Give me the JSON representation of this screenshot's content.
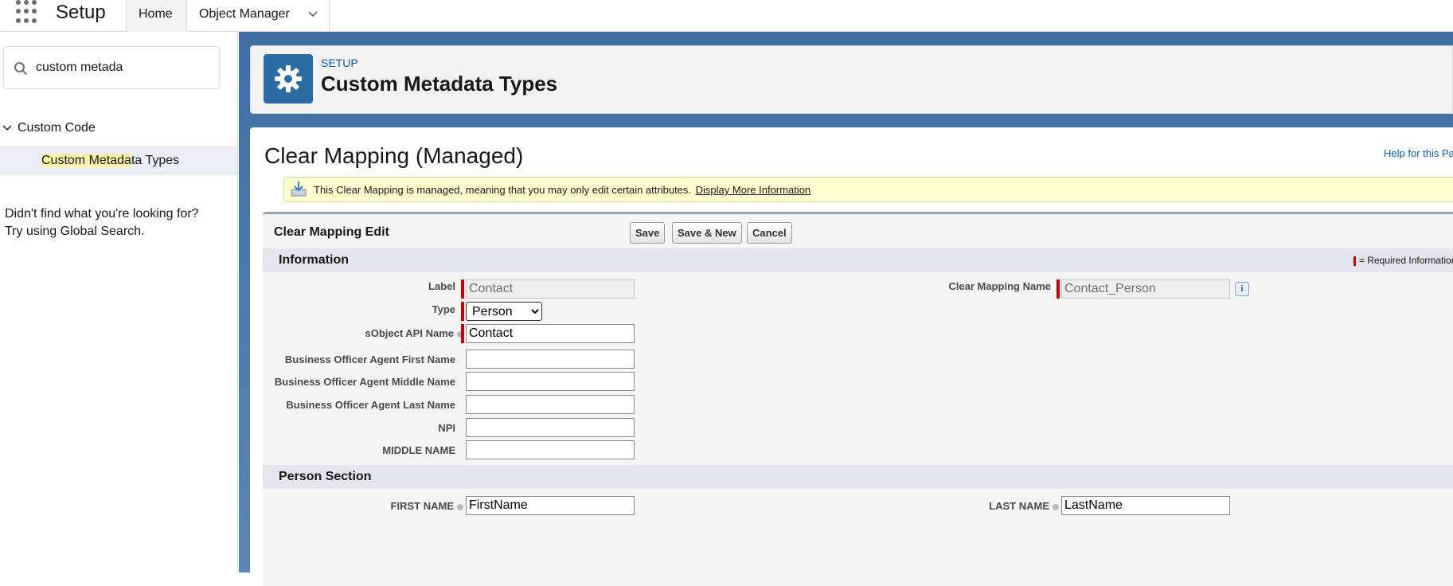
{
  "topbar": {
    "app_name": "Setup",
    "tabs": [
      {
        "label": "Home"
      },
      {
        "label": "Object Manager"
      }
    ]
  },
  "sidebar": {
    "search_value": "custom metada",
    "tree_parent": "Custom Code",
    "tree_child_highlight": "Custom Metada",
    "tree_child_rest": "ta Types",
    "not_found_line1": "Didn't find what you're looking for?",
    "not_found_line2": "Try using Global Search."
  },
  "header": {
    "eyebrow": "SETUP",
    "title": "Custom Metadata Types"
  },
  "page": {
    "title": "Clear Mapping (Managed)",
    "help_link": "Help for this Page",
    "managed_message": "This Clear Mapping is managed, meaning that you may only edit certain attributes.",
    "managed_link": "Display More Information"
  },
  "edit_block": {
    "title": "Clear Mapping Edit",
    "buttons": {
      "save": "Save",
      "save_new": "Save & New",
      "cancel": "Cancel"
    },
    "required_legend": "= Required Information"
  },
  "sections": {
    "information": "Information",
    "person": "Person Section"
  },
  "fields": {
    "label": {
      "label": "Label",
      "value": "Contact"
    },
    "clear_mapping_name": {
      "label": "Clear Mapping Name",
      "value": "Contact_Person"
    },
    "type": {
      "label": "Type",
      "value": "Person"
    },
    "sobject_api_name": {
      "label": "sObject API Name",
      "value": "Contact"
    },
    "bo_first": {
      "label": "Business Officer Agent First Name",
      "value": ""
    },
    "bo_middle": {
      "label": "Business Officer Agent Middle Name",
      "value": ""
    },
    "bo_last": {
      "label": "Business Officer Agent Last Name",
      "value": ""
    },
    "npi": {
      "label": "NPI",
      "value": ""
    },
    "middle_name": {
      "label": "MIDDLE NAME",
      "value": ""
    },
    "first_name": {
      "label": "FIRST NAME",
      "value": "FirstName"
    },
    "last_name": {
      "label": "LAST NAME",
      "value": "LastName"
    }
  },
  "colors": {
    "brand_blue": "#2b6ca3",
    "link_blue": "#0b5cab",
    "required_red": "#cc0000",
    "message_yellow": "#ffffd0"
  },
  "icons": [
    "app-launcher-icon",
    "chevron-down-icon",
    "search-icon",
    "chevron-down-icon",
    "gear-icon",
    "download-icon",
    "info-icon",
    "help-icon"
  ]
}
